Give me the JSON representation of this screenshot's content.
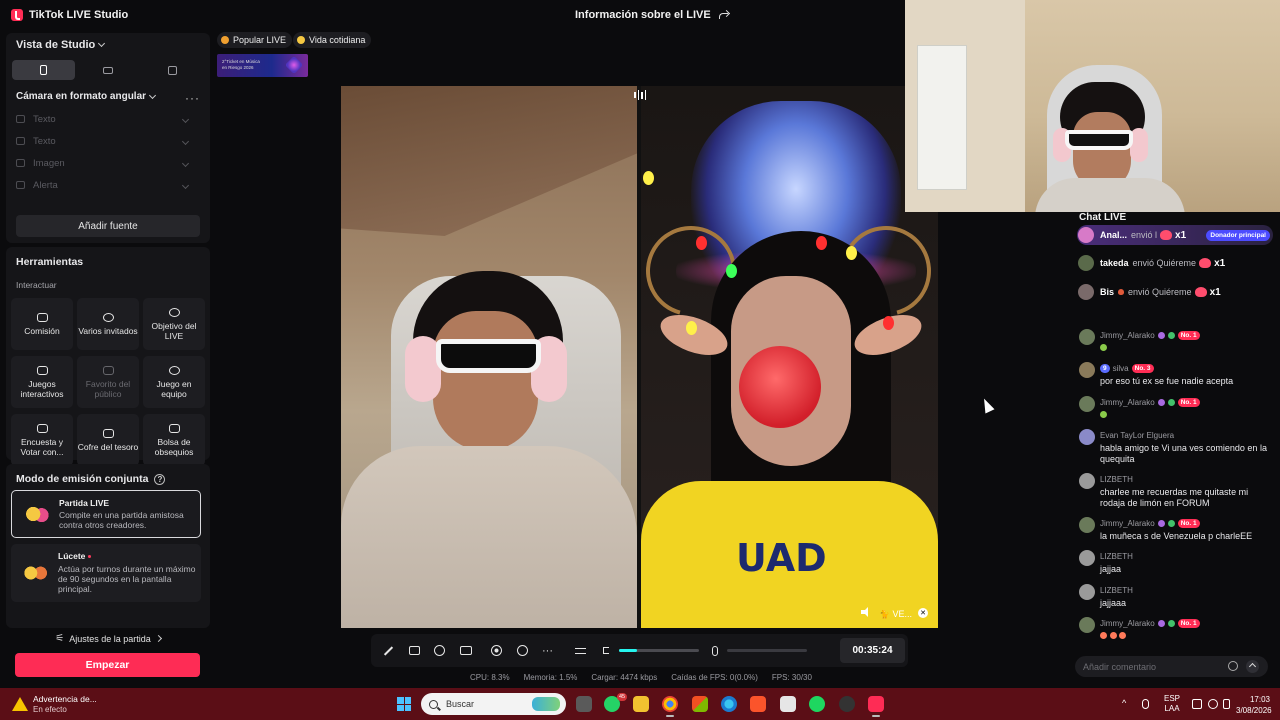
{
  "app": {
    "title": "TikTok LIVE Studio",
    "live_info": "Información sobre el LIVE"
  },
  "studio": {
    "view_label": "Vista de Studio",
    "scene_label": "Cámara en formato angular",
    "sources": [
      "Texto",
      "Texto",
      "Imagen",
      "Alerta"
    ],
    "add_source": "Añadir fuente"
  },
  "tools": {
    "title": "Herramientas",
    "subtitle": "Interactuar",
    "items": [
      {
        "label": "Comisión",
        "enabled": true
      },
      {
        "label": "Varios invitados",
        "enabled": true
      },
      {
        "label": "Objetivo del LIVE",
        "enabled": true
      },
      {
        "label": "Juegos interactivos",
        "enabled": true
      },
      {
        "label": "Favorito del público",
        "enabled": false
      },
      {
        "label": "Juego en equipo",
        "enabled": true
      },
      {
        "label": "Encuesta y Votar con...",
        "enabled": true
      },
      {
        "label": "Cofre del tesoro",
        "enabled": true
      },
      {
        "label": "Bolsa de obsequios",
        "enabled": true
      }
    ]
  },
  "coemission": {
    "title": "Modo de emisión conjunta",
    "modes": [
      {
        "name": "Partida LIVE",
        "desc": "Compite en una partida amistosa contra otros creadores."
      },
      {
        "name": "Lúcete",
        "desc": "Actúa por turnos durante un máximo de 90 segundos en la pantalla principal."
      }
    ],
    "match_settings": "Ajustes de la partida",
    "start_button": "Empezar"
  },
  "tags": [
    "Popular LIVE",
    "Vida cotidiana"
  ],
  "banner_text": "2°Ticket en Música en Riesgo 2026",
  "partner_label": "VE...",
  "controls": {
    "timer": "00:35:24",
    "volume": 0.22
  },
  "stats": {
    "cpu": "CPU: 8.3%",
    "memory": "Memoria: 1.5%",
    "upload": "Cargar: 4474 kbps",
    "fps_drops": "Caídas de FPS: 0(0.0%)",
    "fps": "FPS: 30/30"
  },
  "chat": {
    "title": "Chat LIVE",
    "gifts": [
      {
        "name": "Anal...",
        "text": "envió l",
        "qty": "x1",
        "badge": "Donador principal"
      },
      {
        "name": "takeda",
        "text": "envió Quiéreme",
        "qty": "x1",
        "badge": ""
      },
      {
        "name": "Bis",
        "text": "envió Quiéreme",
        "qty": "x1",
        "badge": ""
      }
    ],
    "messages": [
      {
        "user": "Jimmy_Alarako",
        "badge": "No. 1",
        "level": "",
        "text": ""
      },
      {
        "user": "silva",
        "badge": "No. 3",
        "level": "9",
        "text": "por eso tú ex se fue nadie acepta"
      },
      {
        "user": "Jimmy_Alarako",
        "badge": "No. 1",
        "level": "",
        "text": ""
      },
      {
        "user": "Evan TayLor Elguera",
        "badge": "",
        "level": "",
        "text": "habla amigo te Vi una ves comiendo en la quequita"
      },
      {
        "user": "LIZBETH",
        "badge": "",
        "level": "",
        "text": "charlee me recuerdas me quitaste mi rodaja de limón en FORUM"
      },
      {
        "user": "Jimmy_Alarako",
        "badge": "No. 1",
        "level": "",
        "text": "la muñeca s de Venezuela p charleEE"
      },
      {
        "user": "LIZBETH",
        "badge": "",
        "level": "",
        "text": "jajjaa"
      },
      {
        "user": "LIZBETH",
        "badge": "",
        "level": "",
        "text": "jajjaaa"
      },
      {
        "user": "Jimmy_Alarako",
        "badge": "No. 1",
        "level": "",
        "text": ""
      }
    ],
    "comment_placeholder": "Añadir comentario"
  },
  "taskbar": {
    "warning_title": "Advertencia de...",
    "warning_sub": "En efecto",
    "search_placeholder": "Buscar",
    "whatsapp_badge": "45",
    "lang_top": "ESP",
    "lang_bottom": "LAA",
    "time": "17:03",
    "date": "3/08/2026"
  }
}
